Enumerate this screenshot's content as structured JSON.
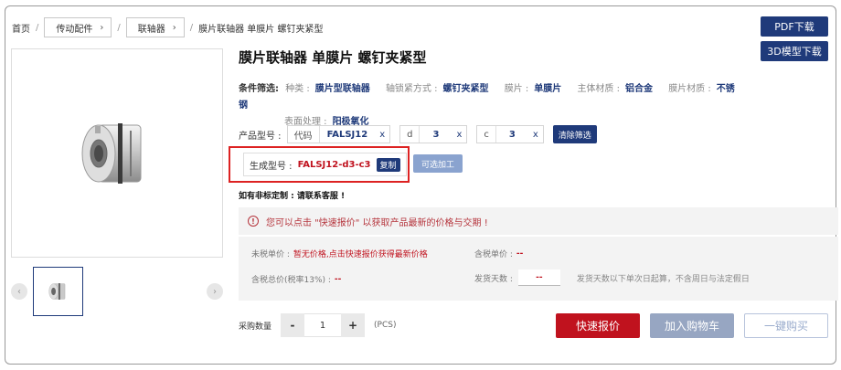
{
  "breadcrumb": {
    "home": "首页",
    "level1": "传动配件",
    "level2": "联轴器",
    "current": "膜片联轴器 单膜片 螺钉夹紧型"
  },
  "downloads": {
    "pdf_label": "PDF下载",
    "cad_label": "3D模型下载"
  },
  "product": {
    "title": "膜片联轴器 单膜片 螺钉夹紧型"
  },
  "filters": {
    "label": "条件筛选:",
    "items": [
      {
        "key": "种类 :",
        "value": "膜片型联轴器"
      },
      {
        "key": "轴锁紧方式 :",
        "value": "螺钉夹紧型"
      },
      {
        "key": "膜片 :",
        "value": "单膜片"
      },
      {
        "key": "主体材质 :",
        "value": "铝合金"
      },
      {
        "key": "膜片材质 :",
        "value": "不锈钢"
      },
      {
        "key": "表面处理 :",
        "value": "阳极氧化"
      }
    ]
  },
  "model": {
    "label": "产品型号 :",
    "params": [
      {
        "key": "代码",
        "value": "FALSJ12",
        "remove": "x"
      },
      {
        "key": "d",
        "value": "3",
        "remove": "x"
      },
      {
        "key": "c",
        "value": "3",
        "remove": "x"
      }
    ],
    "clear_label": "清除筛选"
  },
  "generated": {
    "label": "生成型号 :",
    "code": "FALSJ12-d3-c3",
    "copy_label": "复制",
    "optional_label": "可选加工"
  },
  "custom_note": "如有非标定制 : 请联系客服 !",
  "notice": {
    "icon": "!",
    "text": "您可以点击 \"快速报价\" 以获取产品最新的价格与交期 !"
  },
  "pricing": {
    "untaxed_label": "未税单价 :",
    "untaxed_value": "暂无价格,点击快速报价获得最新价格",
    "taxed_label": "含税单价 :",
    "taxed_value": "--",
    "total_label": "含税总价(税率13%) :",
    "total_value": "--",
    "days_label": "发货天数 :",
    "days_value": "--",
    "days_note": "发货天数以下单次日起算，不含周日与法定假日"
  },
  "quantity": {
    "label": "采购数量",
    "minus": "-",
    "value": "1",
    "plus": "+",
    "unit": "(PCS)"
  },
  "actions": {
    "quote": "快速报价",
    "cart": "加入购物车",
    "buy": "一键购买"
  },
  "gallery": {
    "prev": "‹",
    "next": "›"
  },
  "colors": {
    "brand": "#1f3a7a",
    "accent": "#c0121e"
  }
}
